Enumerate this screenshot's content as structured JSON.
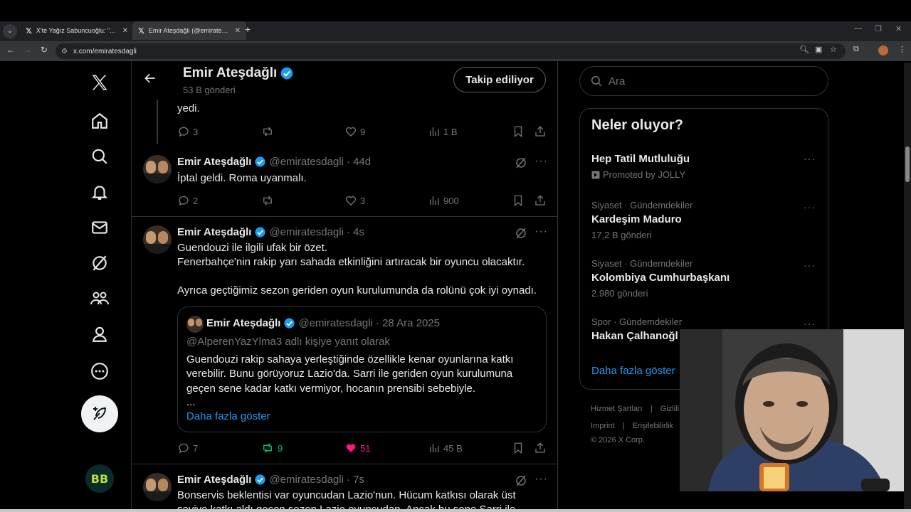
{
  "browser": {
    "tabs": [
      {
        "title": "X'te Yağız Sabuncuoğlu: \"ÖZEL |",
        "active": false
      },
      {
        "title": "Emir Ateşdağlı (@emiratesdagli)",
        "active": true
      }
    ],
    "url": "x.com/emiratesdagli"
  },
  "header": {
    "name": "Emir Ateşdağlı",
    "post_count": "53 B gönderi",
    "follow_label": "Takip ediliyor"
  },
  "tweets": [
    {
      "text": "yedi.",
      "reply": "3",
      "retweet": "",
      "like": "9",
      "views": "1 B"
    },
    {
      "name": "Emir Ateşdağlı",
      "handle": "@emiratesdagli",
      "time": "· 44d",
      "text": "İptal geldi. Roma uyanmalı.",
      "reply": "2",
      "retweet": "",
      "like": "3",
      "views": "900"
    },
    {
      "name": "Emir Ateşdağlı",
      "handle": "@emiratesdagli",
      "time": "· 4s",
      "line1": "Guendouzi ile ilgili ufak bir özet.",
      "line2": "Fenerbahçe'nin rakip yarı sahada etkinliğini artıracak bir oyuncu olacaktır.",
      "line3": "Ayrıca geçtiğimiz sezon geriden oyun kurulumunda da rolünü çok iyi oynadı.",
      "reply": "7",
      "retweet": "9",
      "like": "51",
      "views": "45 B",
      "quote": {
        "name": "Emir Ateşdağlı",
        "handle": "@emiratesdagli",
        "time": "· 28 Ara 2025",
        "reply_to": "@AlperenYazYlma3 adlı kişiye yanıt olarak",
        "line1": "Guendouzi rakip sahaya yerleştiğinde özellikle kenar oyunlarına katkı",
        "line2": "verebilir. Bunu görüyoruz Lazio'da. Sarri ile geriden oyun kurulumuna",
        "line3": "geçen sene kadar katkı vermiyor, hocanın prensibi sebebiyle.",
        "ellipsis": "...",
        "show_more": "Daha fazla göster"
      }
    },
    {
      "name": "Emir Ateşdağlı",
      "handle": "@emiratesdagli",
      "time": "· 7s",
      "line1": "Bonservis beklentisi var oyuncudan Lazio'nun. Hücum katkısı olarak üst",
      "line2": "seviye katkı aldı geçen sezon Lazio oyuncudan. Ancak bu sene Sarri ile"
    }
  ],
  "sidebar_right": {
    "search_placeholder": "Ara",
    "trends_title": "Neler oluyor?",
    "trends": [
      {
        "context": "",
        "title": "Hep Tatil Mutluluğu",
        "sub": "Promoted by JOLLY"
      },
      {
        "context": "Siyaset · Gündemdekiler",
        "title": "Kardeşim Maduro",
        "sub": "17,2 B gönderi"
      },
      {
        "context": "Siyaset · Gündemdekiler",
        "title": "Kolombiya Cumhurbaşkanı",
        "sub": "2.980 gönderi"
      },
      {
        "context": "Spor · Gündemdekiler",
        "title": "Hakan Çalhanoğl",
        "sub": ""
      }
    ],
    "show_more": "Daha fazla göster",
    "footer": {
      "line1a": "Hizmet Şartları",
      "line1b": "Gizlili",
      "line2a": "Imprint",
      "line2b": "Erişilebilirlik",
      "copyright": "© 2026 X Corp."
    }
  },
  "colors": {
    "accent": "#1d9bf0",
    "like_active": "#f91880",
    "retweet_active": "#00ba7c"
  }
}
